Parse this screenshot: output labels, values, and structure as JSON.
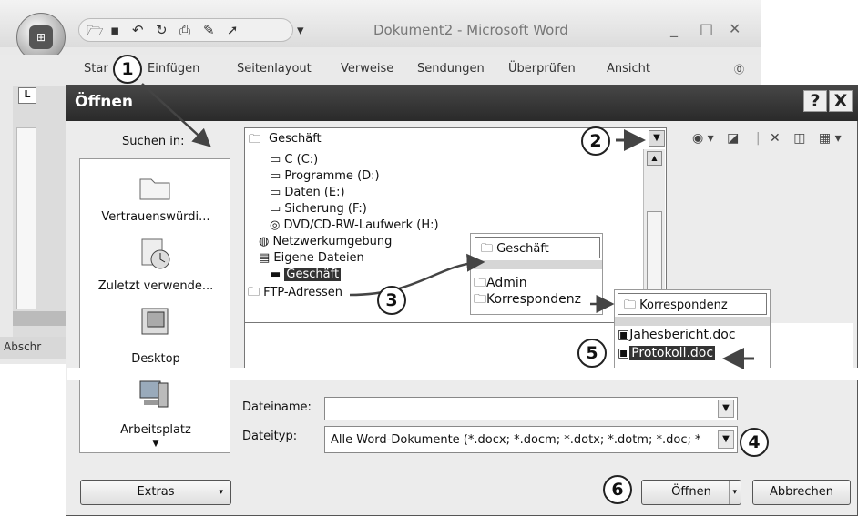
{
  "word": {
    "title": "Dokument2 - Microsoft Word",
    "ribbon_tabs": [
      "Star",
      "Einfügen",
      "Seitenlayout",
      "Verweise",
      "Sendungen",
      "Überprüfen",
      "Ansicht"
    ],
    "ruler_tab": "L",
    "status_text": "Abschr"
  },
  "dialog": {
    "title": "Öffnen",
    "help": "?",
    "close": "X",
    "lookin_label": "Suchen in:",
    "lookin_value": "Geschäft",
    "places": [
      "Vertrauenswürdi...",
      "Zuletzt verwende...",
      "Desktop",
      "Arbeitsplatz"
    ],
    "tree": [
      {
        "label": "C (C:)",
        "icon": "drive-icon"
      },
      {
        "label": "Programme (D:)",
        "icon": "drive-icon"
      },
      {
        "label": "Daten (E:)",
        "icon": "drive-icon"
      },
      {
        "label": "Sicherung (F:)",
        "icon": "drive-icon"
      },
      {
        "label": "DVD/CD-RW-Laufwerk (H:)",
        "icon": "cd-drive-icon"
      },
      {
        "label": "Netzwerkumgebung",
        "icon": "network-icon"
      },
      {
        "label": "Eigene Dateien",
        "icon": "documents-icon"
      },
      {
        "label": "Geschäft",
        "icon": "folder-icon",
        "selected": true
      },
      {
        "label": "FTP-Adressen",
        "icon": "folder-icon"
      }
    ],
    "popup1": {
      "select": "Geschäft",
      "items": [
        "Admin",
        "Korrespondenz"
      ]
    },
    "popup2": {
      "select": "Korrespondenz",
      "items": [
        "Jahesbericht.doc",
        "Protokoll.doc"
      ]
    },
    "filename_label": "Dateiname:",
    "filename_value": "",
    "filetype_label": "Dateityp:",
    "filetype_value": "Alle Word-Dokumente (*.docx; *.docm; *.dotx; *.dotm; *.doc; *",
    "extras_label": "Extras",
    "open_label": "Öffnen",
    "cancel_label": "Abbrechen"
  },
  "callouts": [
    "1",
    "2",
    "3",
    "4",
    "5",
    "6"
  ]
}
